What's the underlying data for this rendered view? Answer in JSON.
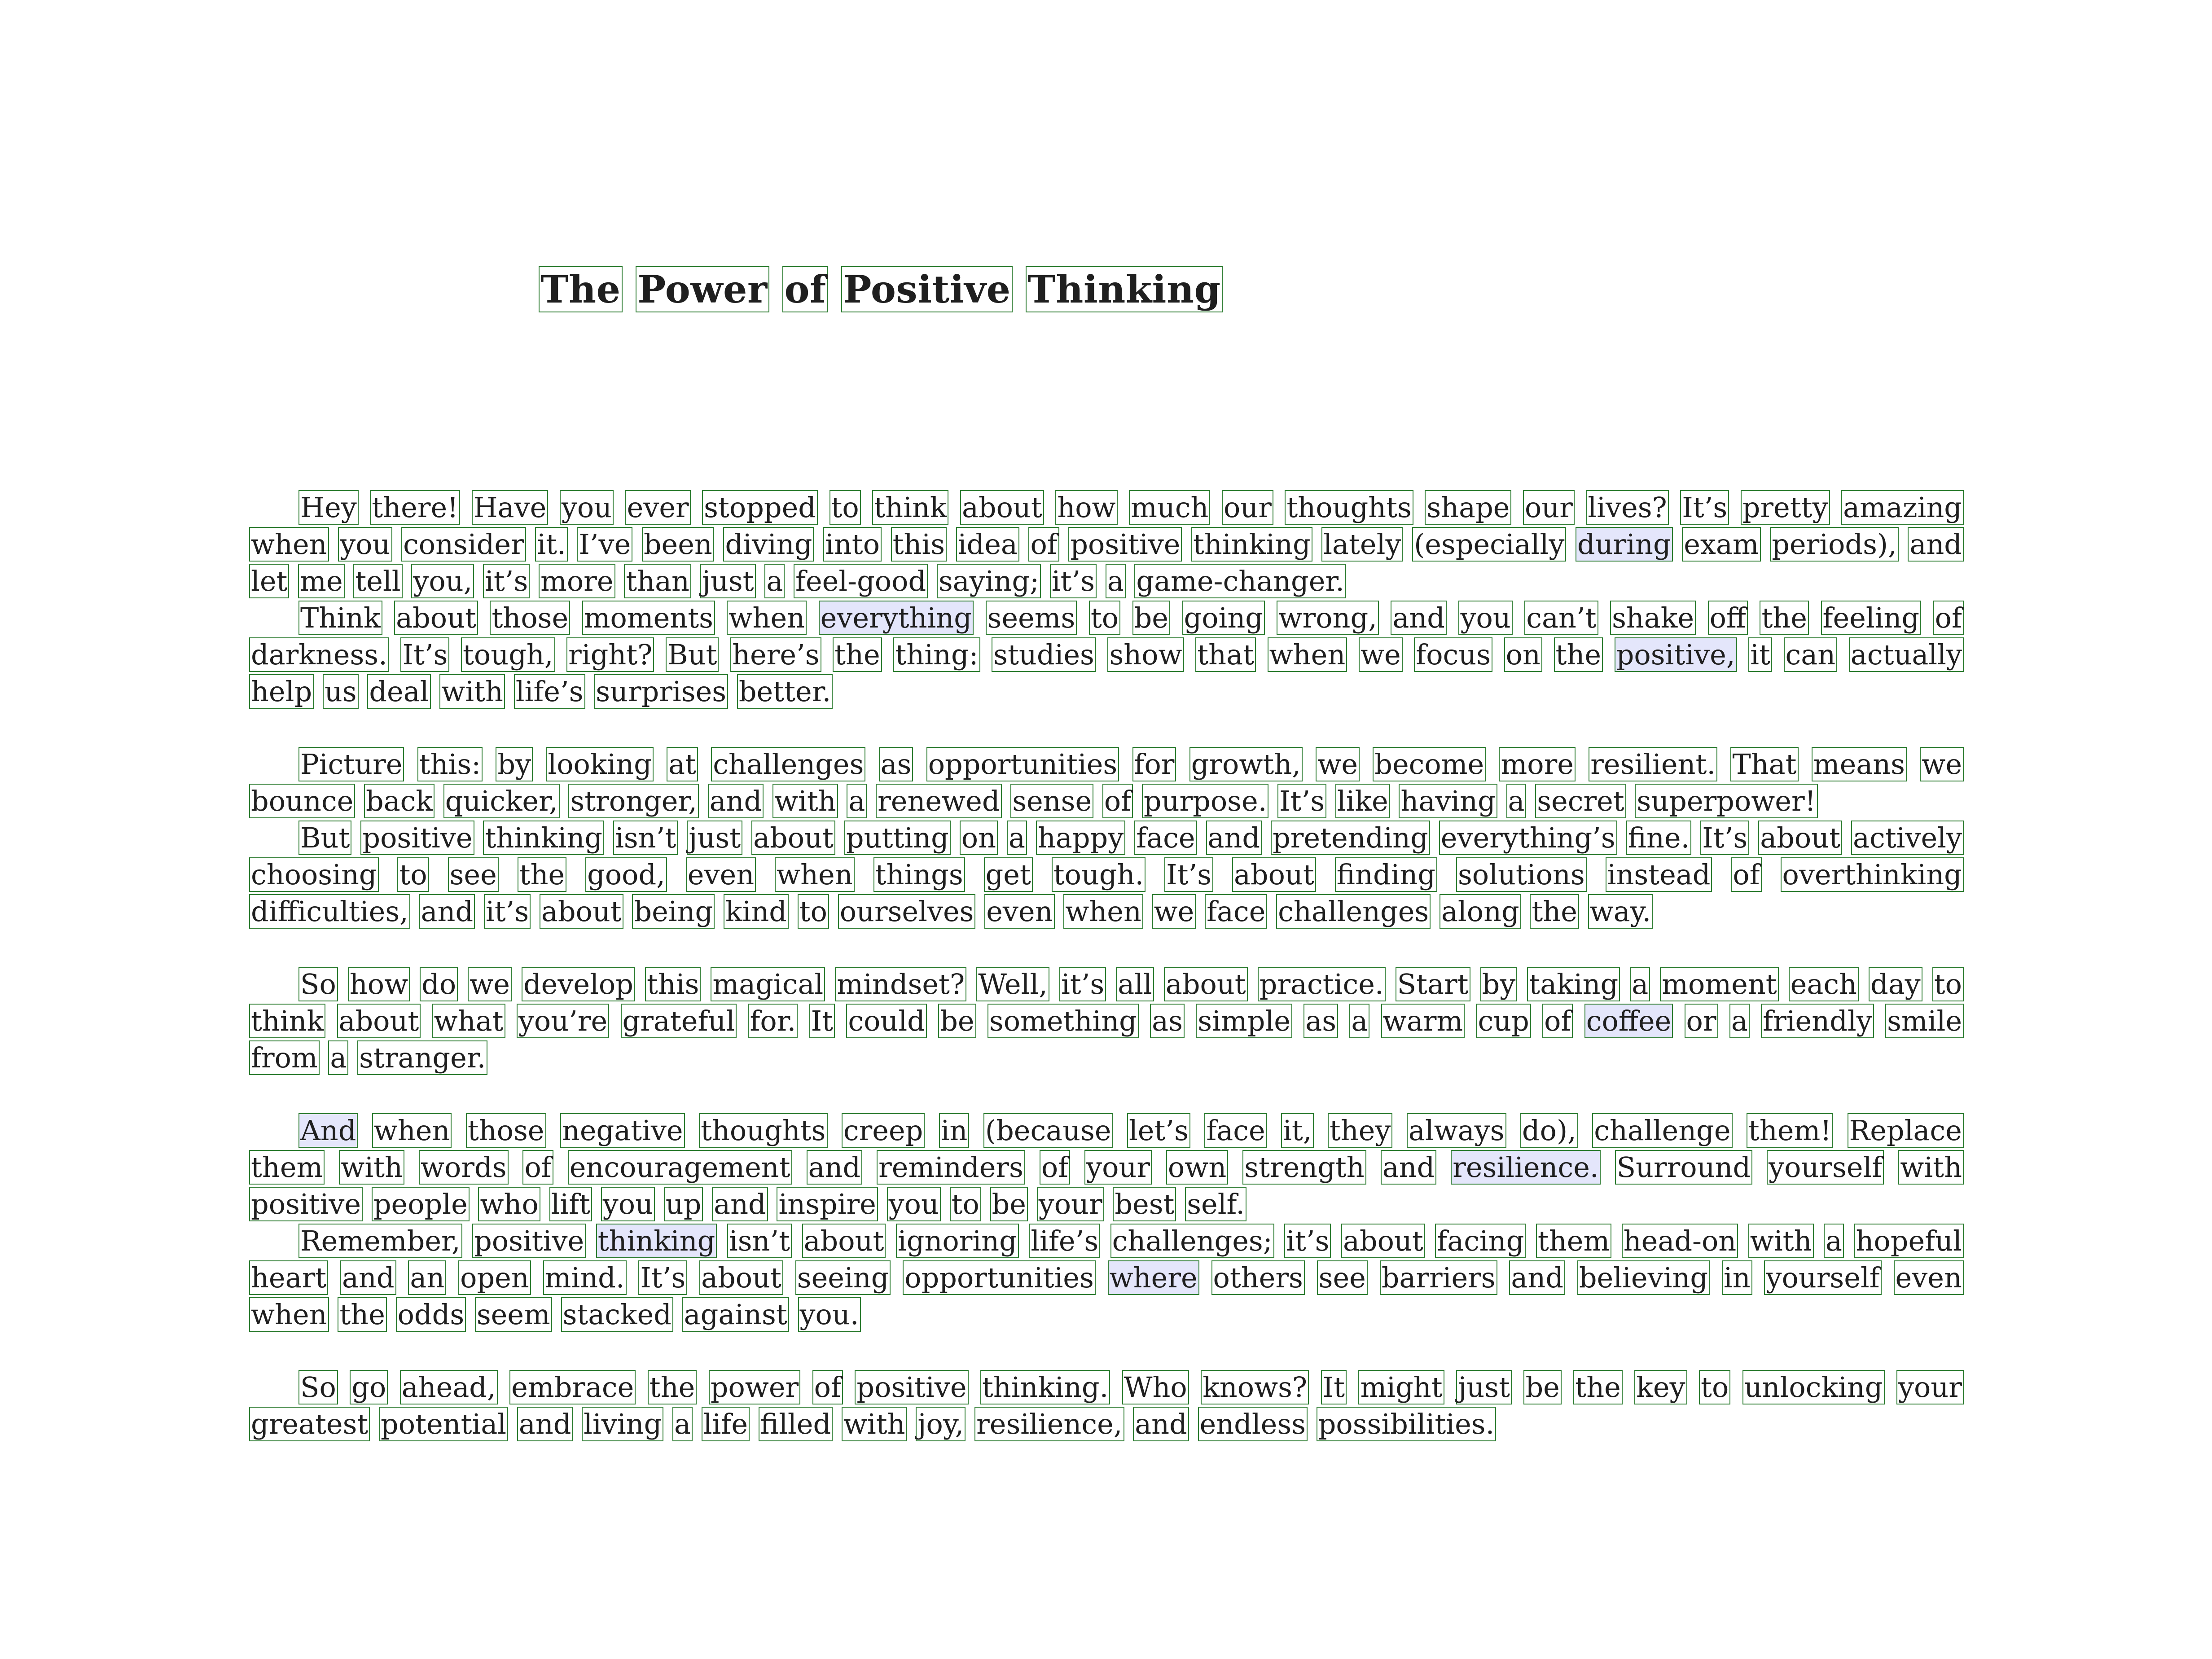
{
  "title": "The Power of Positive Thinking",
  "paragraphs": [
    {
      "text": "Hey there! Have you ever stopped to think about how much our thoughts shape our lives? It’s pretty amazing when you consider it. I’ve been diving into this idea of positive thinking lately (especially during exam periods), and let me tell you, it’s more than just a feel-good saying; it’s a game-changer.",
      "highlights": [
        "during"
      ],
      "gap_before": false
    },
    {
      "text": "Think about those moments when everything seems to be going wrong, and you can’t shake off the feeling of darkness. It’s tough, right? But here’s the thing: studies show that when we focus on the positive, it can actually help us deal with life’s surprises better.",
      "highlights": [
        "everything",
        "positive,"
      ],
      "gap_before": false
    },
    {
      "text": "Picture this: by looking at challenges as opportunities for growth, we become more resilient. That means we bounce back quicker, stronger, and with a renewed sense of purpose. It’s like having a secret superpower!",
      "highlights": [],
      "gap_before": true
    },
    {
      "text": "But positive thinking isn’t just about putting on a happy face and pretending everything’s fine. It’s about actively choosing to see the good, even when things get tough. It’s about finding solutions instead of overthinking difficulties, and it’s about being kind to ourselves even when we face challenges along the way.",
      "highlights": [],
      "gap_before": false
    },
    {
      "text": "So how do we develop this magical mindset? Well, it’s all about practice. Start by taking a moment each day to think about what you’re grateful for. It could be something as simple as a warm cup of coffee or a friendly smile from a stranger.",
      "highlights": [
        "coffee"
      ],
      "gap_before": true
    },
    {
      "text": "And when those negative thoughts creep in (because let’s face it, they always do), challenge them! Replace them with words of encouragement and reminders of your own strength and resilience. Surround yourself with positive people who lift you up and inspire you to be your best self.",
      "highlights": [
        "And",
        "resilience."
      ],
      "gap_before": true
    },
    {
      "text": "Remember, positive thinking isn’t about ignoring life’s challenges; it’s about facing them head-on with a hopeful heart and an open mind. It’s about seeing opportunities where others see barriers and believing in yourself even when the odds seem stacked against you.",
      "highlights": [
        "thinking",
        "where"
      ],
      "gap_before": false
    },
    {
      "text": "So go ahead, embrace the power of positive thinking. Who knows? It might just be the key to unlocking your greatest potential and living a life filled with joy, resilience, and endless possibilities.",
      "highlights": [],
      "gap_before": true
    }
  ]
}
